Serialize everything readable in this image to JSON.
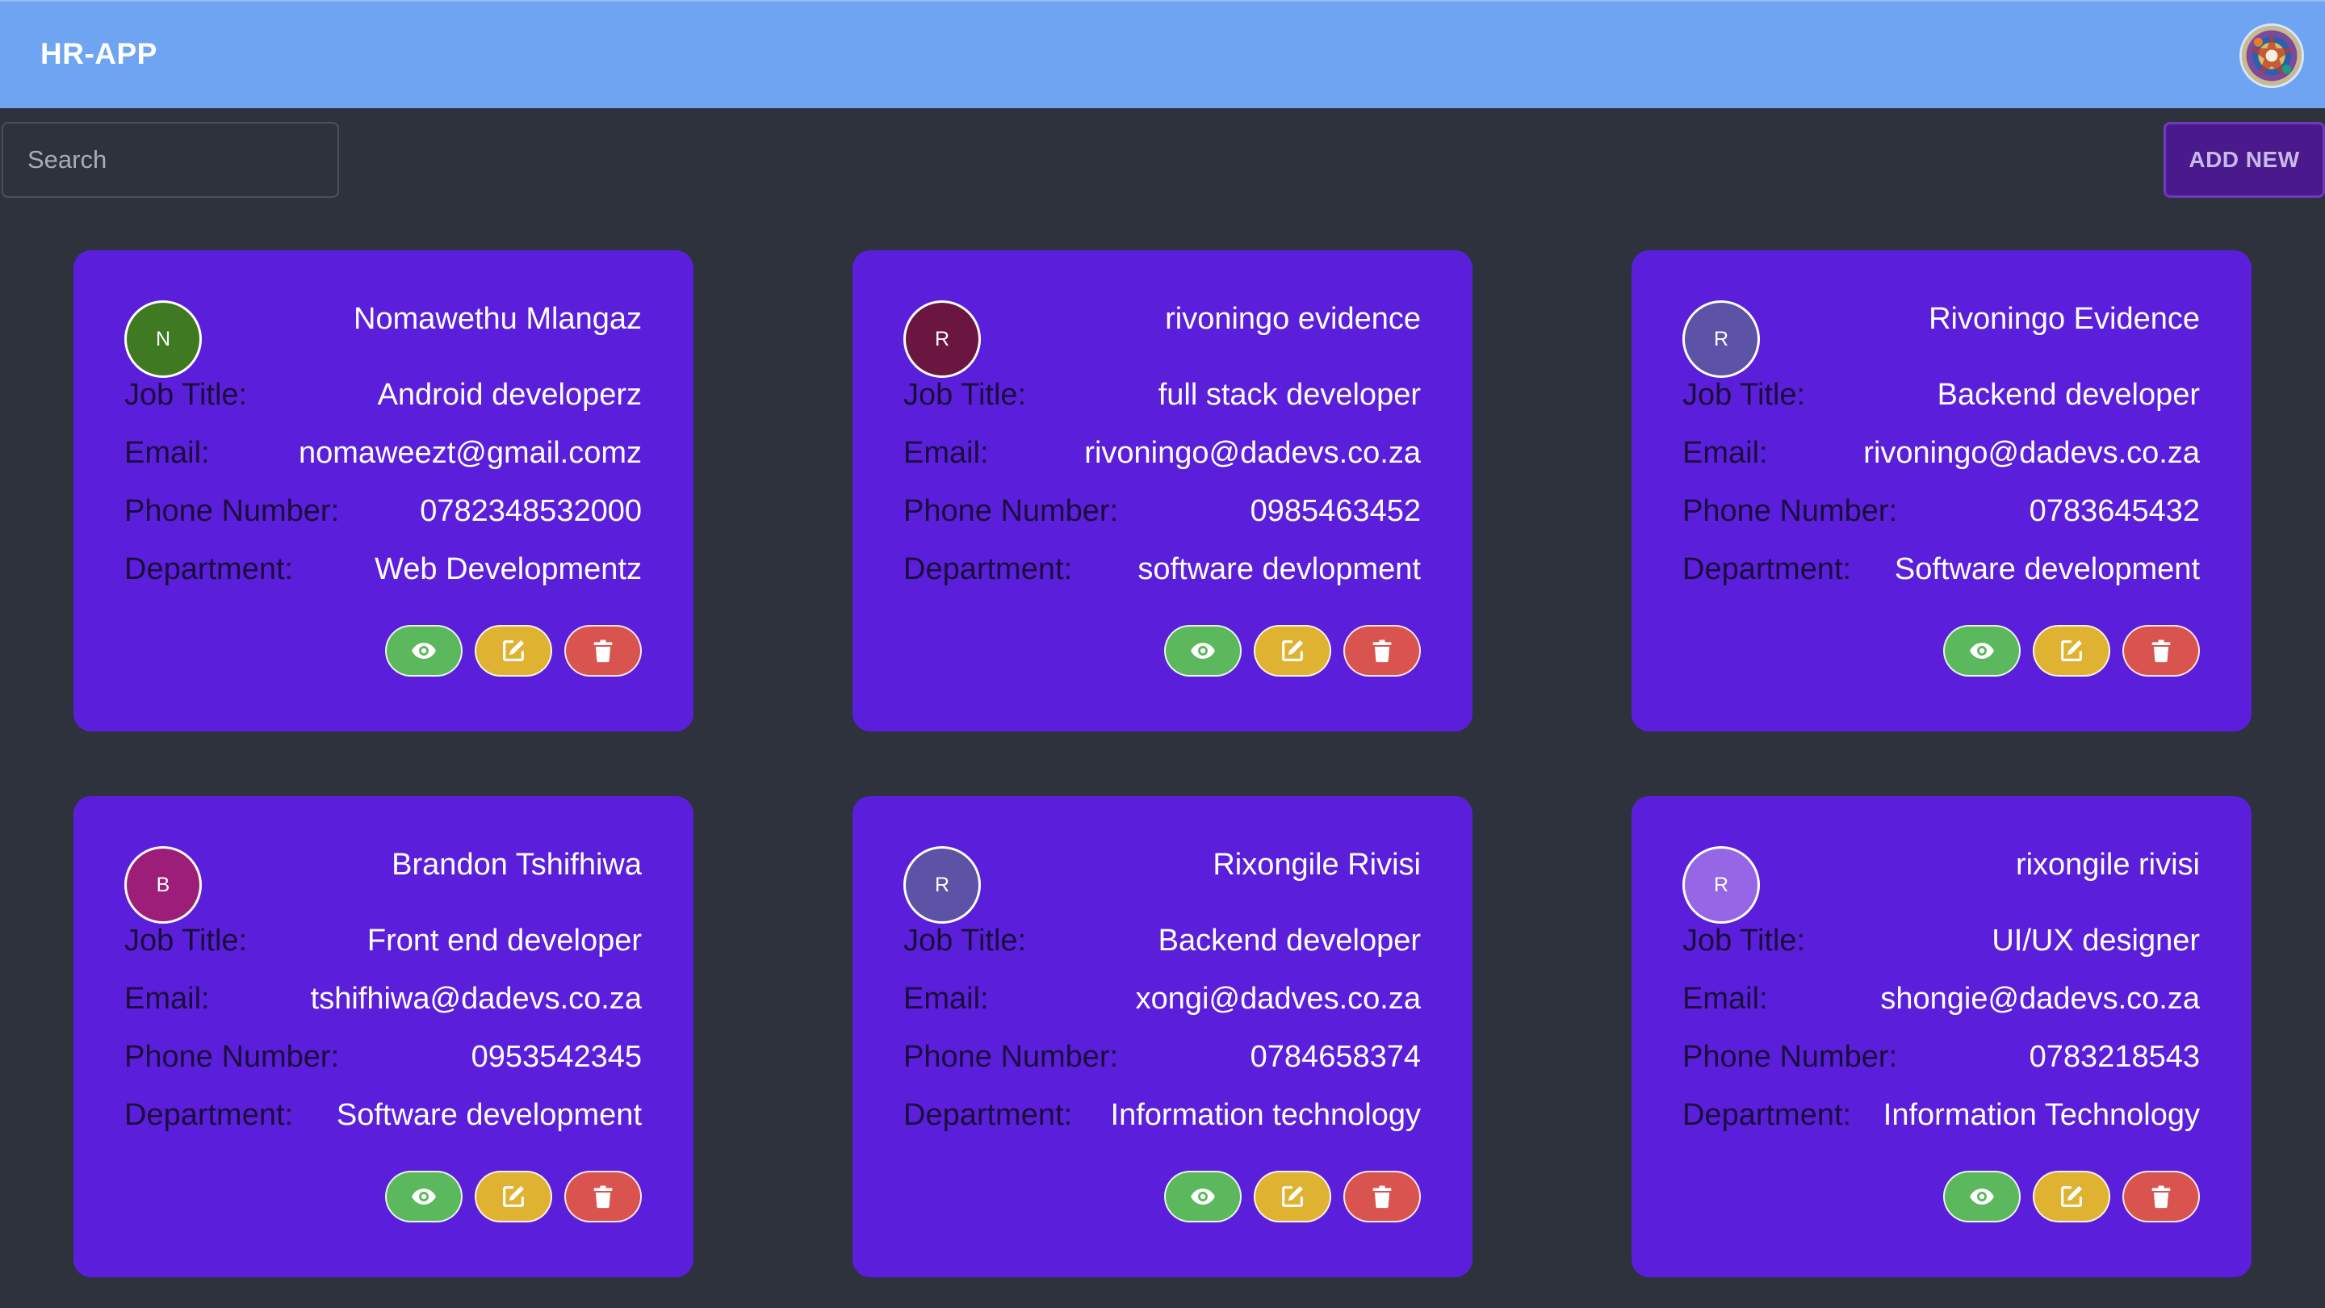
{
  "app": {
    "title": "HR-APP"
  },
  "search": {
    "placeholder": "Search"
  },
  "toolbar": {
    "add_new_label": "ADD NEW"
  },
  "labels": {
    "job_title": "Job Title:",
    "email": "Email:",
    "phone": "Phone Number:",
    "department": "Department:"
  },
  "icons": {
    "view": "eye-icon",
    "edit": "edit-icon",
    "delete": "trash-icon"
  },
  "colors": {
    "header": "#6fa4f3",
    "card": "#5b1fdc",
    "background": "#2e323c",
    "view_button": "#5cb85c",
    "edit_button": "#e0b232",
    "delete_button": "#d9534f"
  },
  "employees": [
    {
      "initial": "N",
      "avatar_color": "#3f7a23",
      "name": "Nomawethu Mlangaz",
      "job_title": "Android developerz",
      "email": "nomaweezt@gmail.comz",
      "phone": "0782348532000",
      "department": "Web Developmentz"
    },
    {
      "initial": "R",
      "avatar_color": "#6b1640",
      "name": "rivoningo evidence",
      "job_title": "full stack developer",
      "email": "rivoningo@dadevs.co.za",
      "phone": "0985463452",
      "department": "software devlopment"
    },
    {
      "initial": "R",
      "avatar_color": "#5c52a6",
      "name": "Rivoningo Evidence",
      "job_title": "Backend developer",
      "email": "rivoningo@dadevs.co.za",
      "phone": "0783645432",
      "department": "Software development"
    },
    {
      "initial": "B",
      "avatar_color": "#9c1e78",
      "name": "Brandon Tshifhiwa",
      "job_title": "Front end developer",
      "email": "tshifhiwa@dadevs.co.za",
      "phone": "0953542345",
      "department": "Software development"
    },
    {
      "initial": "R",
      "avatar_color": "#5c52a6",
      "name": "Rixongile Rivisi",
      "job_title": "Backend developer",
      "email": "xongi@dadves.co.za",
      "phone": "0784658374",
      "department": "Information technology"
    },
    {
      "initial": "R",
      "avatar_color": "#9566e6",
      "name": "rixongile rivisi",
      "job_title": "UI/UX designer",
      "email": "shongie@dadevs.co.za",
      "phone": "0783218543",
      "department": "Information Technology"
    }
  ]
}
